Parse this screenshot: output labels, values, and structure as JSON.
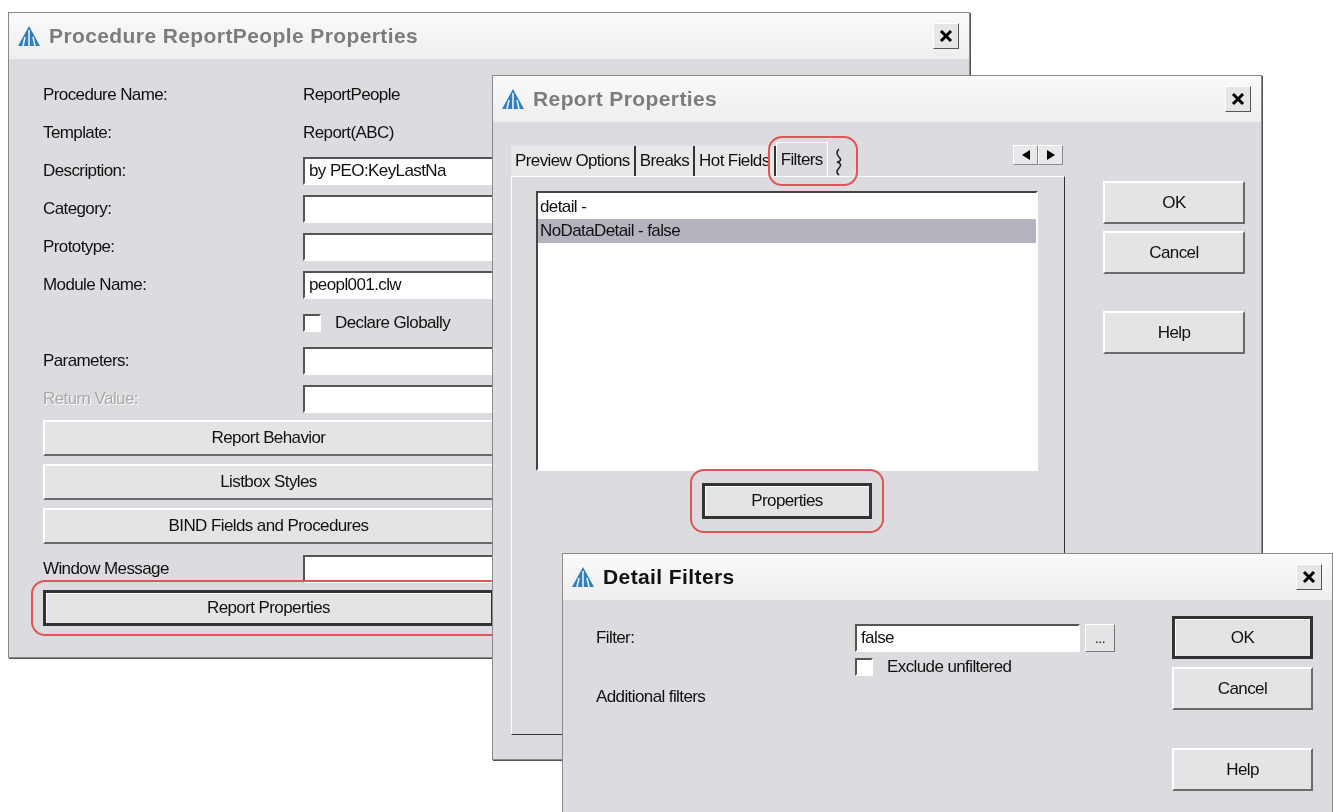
{
  "procedure_dialog": {
    "title": "Procedure ReportPeople Properties",
    "active": false,
    "rows": [
      {
        "kind": "text",
        "label": "Procedure Name:",
        "value": "ReportPeople",
        "disabled": false
      },
      {
        "kind": "text",
        "label": "Template:",
        "value": "Report(ABC)",
        "disabled": false
      },
      {
        "kind": "input",
        "label": "Description:",
        "value": "by PEO:KeyLastNa",
        "disabled": false
      },
      {
        "kind": "input",
        "label": "Category:",
        "disabled": false
      },
      {
        "kind": "input",
        "label": "Prototype:",
        "disabled": false
      },
      {
        "kind": "input",
        "label": "Module Name:",
        "value": "peopl001.clw",
        "disabled": false
      },
      {
        "kind": "checkbox",
        "label": "Declare Globally",
        "checked": false
      },
      {
        "kind": "input",
        "label": "Parameters:",
        "disabled": false
      },
      {
        "kind": "input",
        "label": "Return Value:",
        "disabled": true
      },
      {
        "kind": "button",
        "label": "Report Behavior",
        "default": false,
        "highlighted": false
      },
      {
        "kind": "button",
        "label": "Listbox Styles",
        "default": false,
        "highlighted": false
      },
      {
        "kind": "button",
        "label": "BIND Fields and Procedures",
        "default": false,
        "highlighted": false
      },
      {
        "kind": "input",
        "label": "Window Message",
        "disabled": false
      },
      {
        "kind": "button",
        "label": "Report Properties",
        "default": true,
        "highlighted": true
      }
    ]
  },
  "report_dialog": {
    "title": "Report Properties",
    "active": false,
    "tabs": [
      {
        "label": "Preview Options",
        "selected": false,
        "highlighted": false
      },
      {
        "label": "Breaks",
        "selected": false,
        "highlighted": false
      },
      {
        "label": "Hot Fields",
        "selected": false,
        "highlighted": false
      },
      {
        "label": "Filters",
        "selected": true,
        "highlighted": true
      }
    ],
    "list_items": [
      {
        "text": "detail -",
        "selected": false
      },
      {
        "text": "NoDataDetail - false",
        "selected": true
      }
    ],
    "properties_button": {
      "label": "Properties",
      "default": true,
      "highlighted": true
    },
    "buttons": [
      {
        "label": "OK",
        "default": false
      },
      {
        "label": "Cancel",
        "default": false
      },
      {
        "label": "Help",
        "default": false
      }
    ]
  },
  "filter_dialog": {
    "title": "Detail Filters",
    "active": true,
    "filter_label": "Filter:",
    "filter_value": "false",
    "browse_button": "...",
    "exclude_checkbox": {
      "label": "Exclude unfiltered",
      "checked": false
    },
    "additional_label": "Additional filters",
    "buttons": [
      {
        "label": "OK",
        "default": true
      },
      {
        "label": "Cancel",
        "default": false
      },
      {
        "label": "Help",
        "default": false
      }
    ]
  }
}
